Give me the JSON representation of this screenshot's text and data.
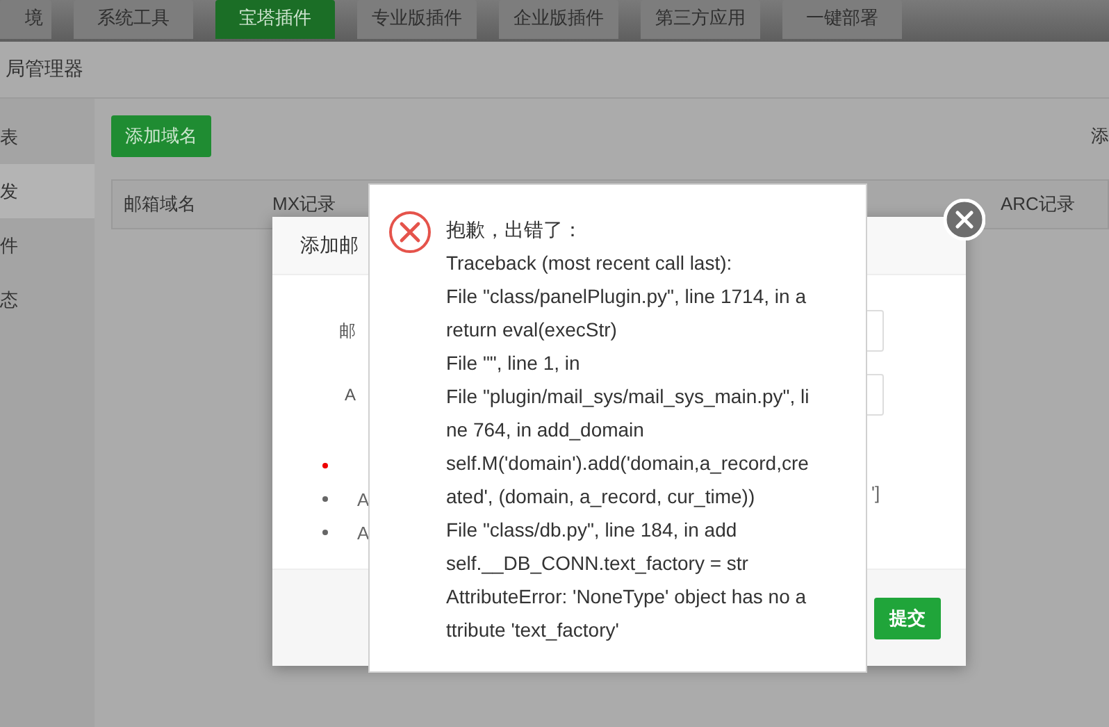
{
  "top_tabs": [
    {
      "label": "境",
      "selected": false
    },
    {
      "label": "系统工具",
      "selected": false
    },
    {
      "label": "宝塔插件",
      "selected": true
    },
    {
      "label": "专业版插件",
      "selected": false
    },
    {
      "label": "企业版插件",
      "selected": false
    },
    {
      "label": "第三方应用",
      "selected": false
    },
    {
      "label": "一键部署",
      "selected": false
    }
  ],
  "page_title": "局管理器",
  "sidebar": {
    "items": [
      {
        "label": "表",
        "selected": false
      },
      {
        "label": "发",
        "selected": true
      },
      {
        "label": "件",
        "selected": false
      },
      {
        "label": "态",
        "selected": false
      }
    ]
  },
  "toolbar": {
    "add_button": "添加域名",
    "right_text": "添"
  },
  "table": {
    "columns": [
      "邮箱域名",
      "MX记录",
      "ARC记录"
    ]
  },
  "dialog": {
    "title": "添加邮",
    "fields": [
      {
        "label": "邮"
      },
      {
        "label": "A"
      }
    ],
    "notes": [
      {
        "kind": "warning"
      },
      {
        "text": "A",
        "kind": "normal"
      },
      {
        "text": "A",
        "kind": "normal"
      }
    ],
    "side_text": "']",
    "submit_button": "提交"
  },
  "error_popup": {
    "lines": [
      "抱歉，出错了：",
      "Traceback (most recent call last):",
      "File \"class/panelPlugin.py\", line 1714, in a",
      "return eval(execStr)",
      "File \"\", line 1, in",
      "File \"plugin/mail_sys/mail_sys_main.py\", li",
      "ne 764, in add_domain",
      "self.M('domain').add('domain,a_record,cre",
      "ated', (domain, a_record, cur_time))",
      "File \"class/db.py\", line 184, in add",
      "self.__DB_CONN.text_factory = str",
      "AttributeError: 'NoneType' object has no a",
      "ttribute 'text_factory'"
    ]
  }
}
